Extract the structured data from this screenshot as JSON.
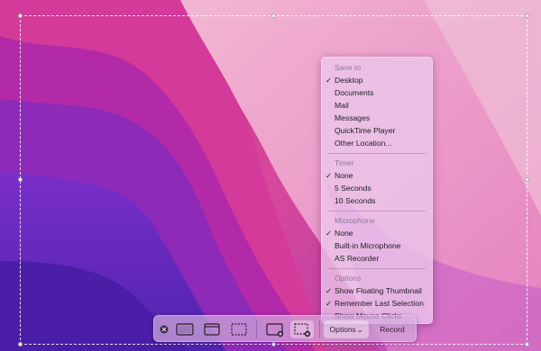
{
  "menu": {
    "sections": {
      "save_to": {
        "header": "Save to",
        "items": [
          "Desktop",
          "Documents",
          "Mail",
          "Messages",
          "QuickTime Player",
          "Other Location..."
        ],
        "checked": "Desktop"
      },
      "timer": {
        "header": "Timer",
        "items": [
          "None",
          "5 Seconds",
          "10 Seconds"
        ],
        "checked": "None"
      },
      "microphone": {
        "header": "Microphone",
        "items": [
          "None",
          "Built-in Microphone",
          "AS Recorder"
        ],
        "checked": "None"
      },
      "options": {
        "header": "Options",
        "items": [
          "Show Floating Thumbnail",
          "Remember Last Selection",
          "Show Mouse Clicks"
        ],
        "checked": [
          "Show Floating Thumbnail",
          "Remember Last Selection"
        ]
      }
    },
    "check_glyph": "✓"
  },
  "toolbar": {
    "options_label": "Options",
    "options_chevron": "⌄",
    "record_label": "Record",
    "close_glyph": "×",
    "icons": [
      "close-icon",
      "capture-entire-screen-icon",
      "capture-window-icon",
      "capture-selection-icon",
      "record-entire-screen-icon",
      "record-selection-icon"
    ]
  },
  "colors": {
    "wallpaper_pink": "#e0409f",
    "wallpaper_purple": "#5a1fb3",
    "wallpaper_violet": "#9a30c8",
    "menu_bg": "#ecc8ec",
    "toolbar_bg": "#d2aadc"
  }
}
